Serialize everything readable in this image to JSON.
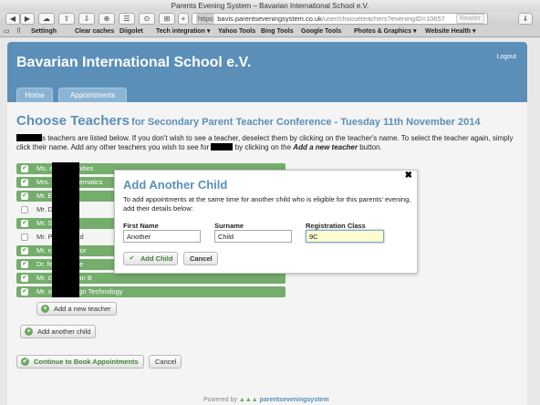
{
  "browser": {
    "title": "Parents Evening System – Bavarian International School e.V.",
    "url_scheme": "https",
    "url_host": "bavis.parentseveningsystem.co.uk",
    "url_path": "/user/chooseteachers?eveningID=10657",
    "reader_label": "Reader",
    "bookmarks": [
      "Settingh",
      "Clear caches",
      "Diigolet",
      "Tech integration ▾",
      "Yahoo Tools",
      "Bing Tools",
      "Google Tools",
      "Photos & Graphics ▾",
      "Website Health ▾"
    ]
  },
  "header": {
    "school_name": "Bavarian International School e.V.",
    "logout": "Logout",
    "tabs": [
      "Home",
      "Appointments"
    ]
  },
  "page": {
    "title": "Choose Teachers",
    "subtitle": "for Secondary Parent Teacher Conference - Tuesday 11th November 2014",
    "intro_a": "s teachers are listed below. If you don't wish to see a teacher, deselect them by clicking on the teacher's name. To select the teacher again, simply click their name.  Add any other teachers you wish to see for",
    "intro_b": "by clicking on the",
    "intro_link": "Add a new teacher",
    "intro_c": "button."
  },
  "teachers": [
    {
      "label": "Ms.            e - Humanities",
      "selected": true
    },
    {
      "label": "Mrs.            er - Mathematics",
      "selected": true
    },
    {
      "label": "Mr.             English",
      "selected": true
    },
    {
      "label": "Mr.             Drama",
      "selected": false
    },
    {
      "label": "Mr.             Spanish",
      "selected": true
    },
    {
      "label": "Mr.             Physical Ed",
      "selected": false
    },
    {
      "label": "Mr.            nce - Mentor",
      "selected": true
    },
    {
      "label": "Dr.            fe - Science",
      "selected": true
    },
    {
      "label": "Mr.            ck - German B",
      "selected": true
    },
    {
      "label": "Mr.            son - Design Technology",
      "selected": true
    }
  ],
  "buttons": {
    "add_teacher": "Add a new teacher",
    "add_child": "Add another child",
    "continue": "Continue to Book Appointments",
    "cancel": "Cancel"
  },
  "footer": {
    "powered_by": "Powered by",
    "logo": "parentseveningsystem"
  },
  "modal": {
    "title": "Add Another Child",
    "description": "To add appointments at the same time for another child who is eligible for this parents' evening, add their details below:",
    "first_name_label": "First Name",
    "first_name_value": "Another",
    "surname_label": "Surname",
    "surname_value": "Child",
    "class_label": "Registration Class",
    "class_value": "9C",
    "add_button": "Add Child",
    "cancel_button": "Cancel",
    "close": "✖"
  },
  "colors": {
    "brand_blue": "#5b8fb7",
    "selected_green": "#74ad6c"
  }
}
